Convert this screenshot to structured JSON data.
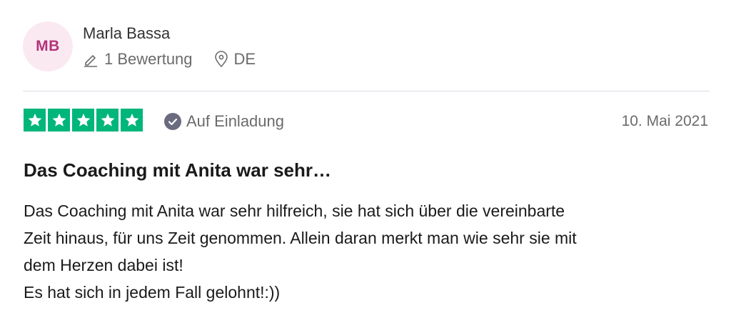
{
  "reviewer": {
    "initials": "MB",
    "name": "Marla Bassa",
    "reviews_count": "1 Bewertung",
    "country": "DE",
    "avatar_bg": "#fbe9f1",
    "avatar_fg": "#b2337a"
  },
  "review": {
    "rating": 5,
    "max_rating": 5,
    "star_color": "#00b67a",
    "badge_label": "Auf Einladung",
    "date": "10. Mai 2021",
    "title": "Das Coaching mit Anita war sehr…",
    "body_lines": [
      "Das Coaching mit Anita war sehr hilfreich, sie hat sich über die vereinbarte",
      "Zeit hinaus, für uns Zeit genommen. Allein daran merkt man wie sehr sie mit",
      "dem Herzen dabei ist!",
      "Es hat sich in jedem Fall gelohnt!:))"
    ]
  }
}
